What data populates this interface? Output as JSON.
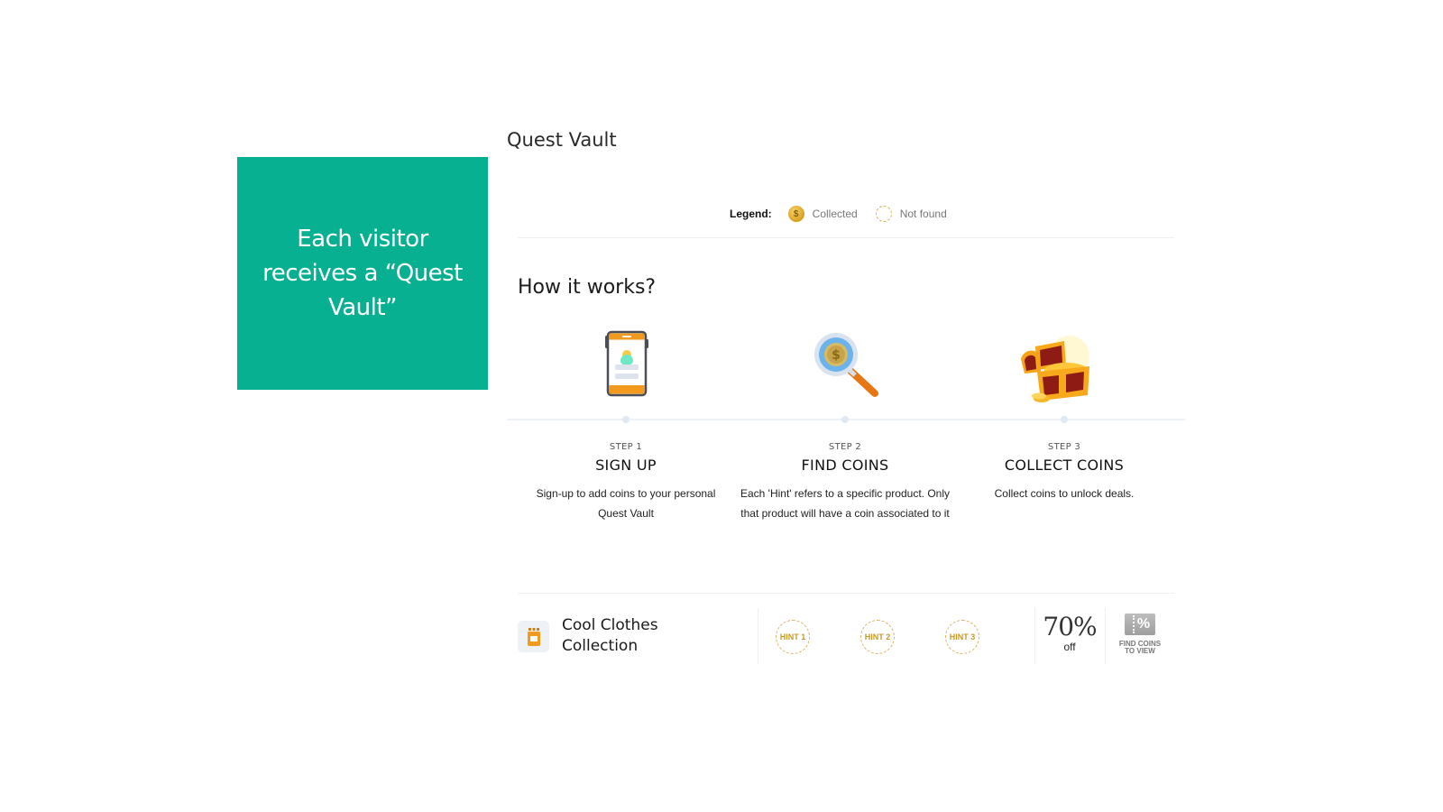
{
  "callout": {
    "text": "Each visitor receives a “Quest Vault”",
    "color": "#07b091"
  },
  "page": {
    "title": "Quest Vault"
  },
  "legend": {
    "label": "Legend:",
    "items": [
      {
        "icon": "coin-collected-icon",
        "label": "Collected"
      },
      {
        "icon": "coin-not-found-icon",
        "label": "Not found"
      }
    ]
  },
  "how_it_works": {
    "title": "How it works?",
    "steps": [
      {
        "number": "STEP 1",
        "title": "SIGN UP",
        "description": "Sign-up to add coins to your personal Quest Vault",
        "icon": "phone-signup-icon"
      },
      {
        "number": "STEP 2",
        "title": "FIND COINS",
        "description": "Each 'Hint' refers to a specific product. Only that product will have a coin associated to it",
        "icon": "magnifier-coin-icon"
      },
      {
        "number": "STEP 3",
        "title": "COLLECT COINS",
        "description": "Collect coins to unlock deals.",
        "icon": "treasure-chest-icon"
      }
    ]
  },
  "product": {
    "name_line1": "Cool Clothes",
    "name_line2": "Collection",
    "icon": "shopping-bag-icon",
    "hints": [
      "HINT 1",
      "HINT 2",
      "HINT 3"
    ],
    "discount_value": "70%",
    "discount_suffix": "off",
    "find_label_line1": "FIND COINS",
    "find_label_line2": "TO VIEW",
    "coupon_symbol": "%"
  }
}
